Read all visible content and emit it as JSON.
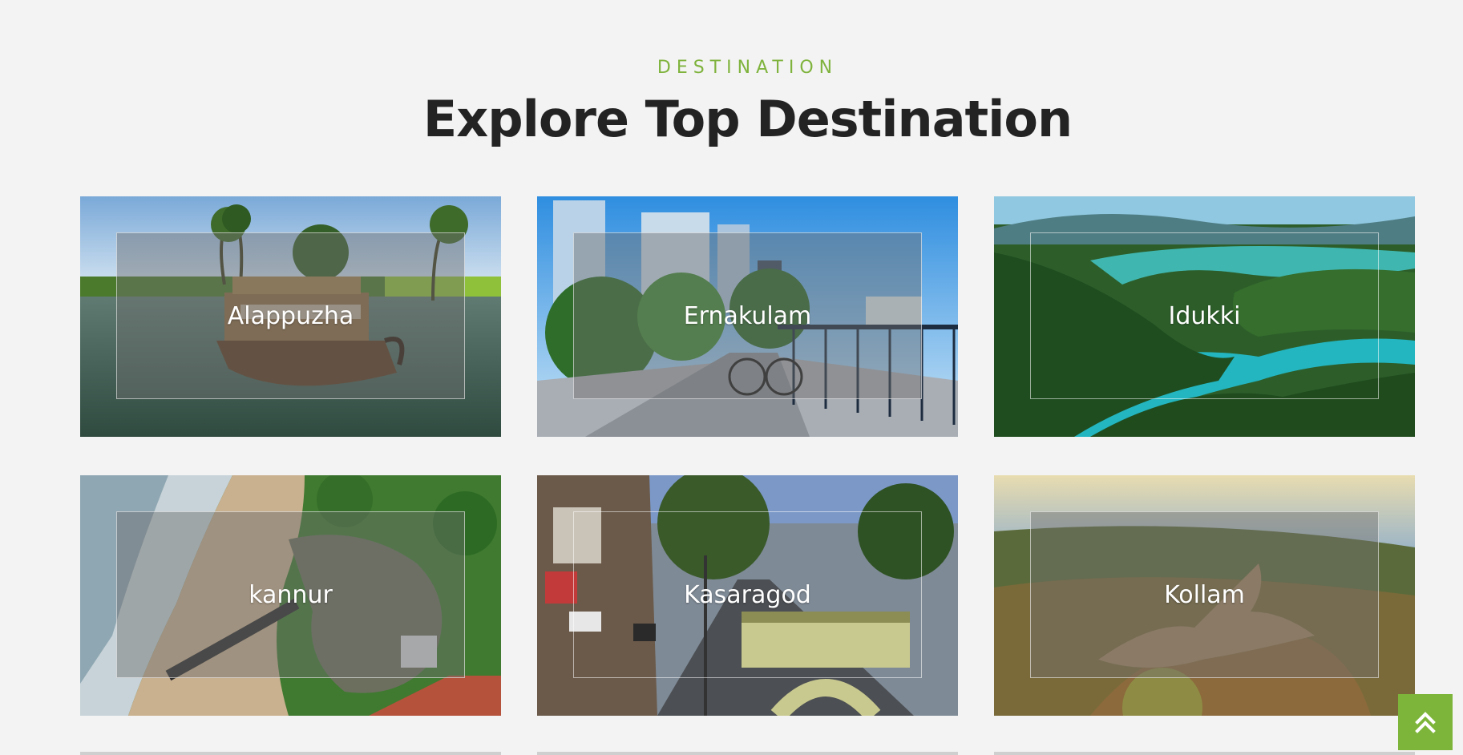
{
  "section": {
    "eyebrow": "DESTINATION",
    "title": "Explore Top Destination"
  },
  "destinations": [
    {
      "name": "Alappuzha"
    },
    {
      "name": "Ernakulam"
    },
    {
      "name": "Idukki"
    },
    {
      "name": "kannur"
    },
    {
      "name": "Kasaragod"
    },
    {
      "name": "Kollam"
    }
  ],
  "scroll_top": {
    "icon": "double-chevron-up-icon"
  },
  "colors": {
    "accent": "#7db53a",
    "heading": "#232323",
    "background": "#f3f3f3"
  }
}
